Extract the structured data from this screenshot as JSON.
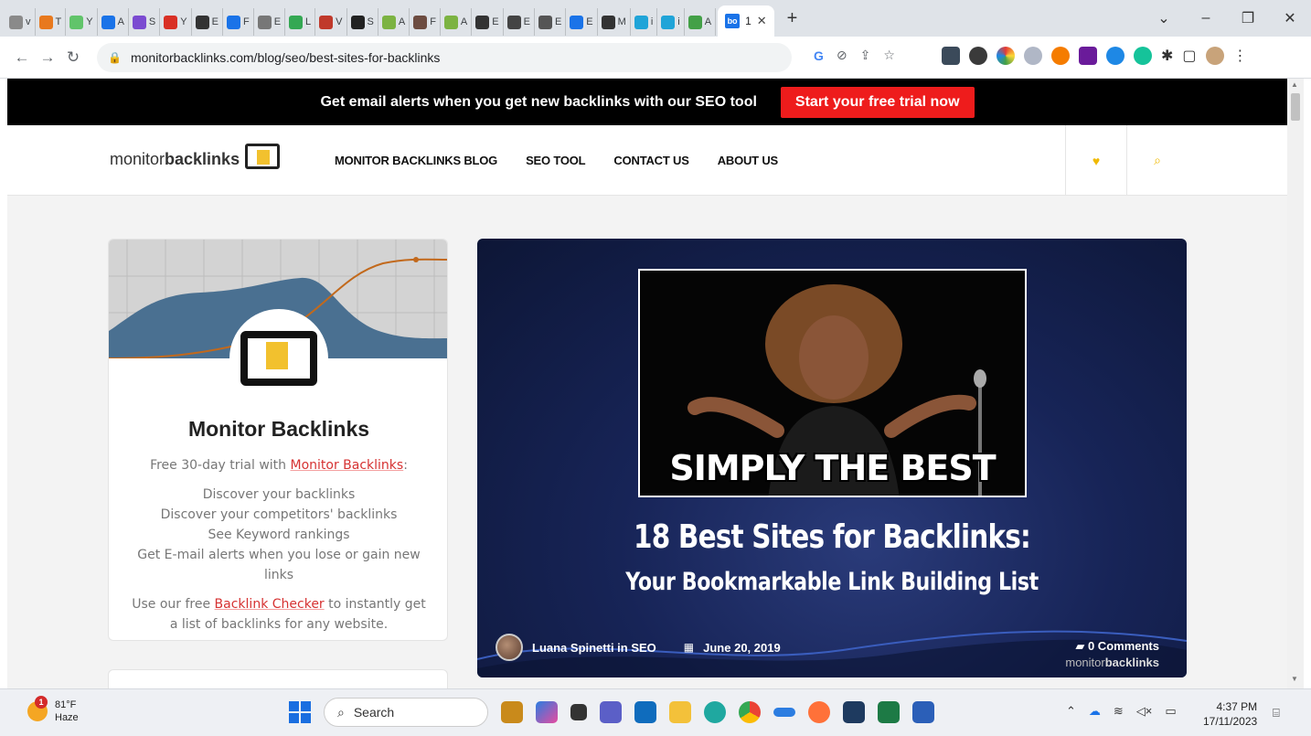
{
  "browser": {
    "tabs": [
      {
        "label": "v",
        "color": "#8a8a8a"
      },
      {
        "label": "T",
        "color": "#e8791e"
      },
      {
        "label": "Y",
        "color": "#61c46a"
      },
      {
        "label": "A",
        "color": "#1a73e8"
      },
      {
        "label": "S",
        "color": "#7b4bd1"
      },
      {
        "label": "Y",
        "color": "#d93025"
      },
      {
        "label": "E",
        "color": "#333333"
      },
      {
        "label": "F",
        "color": "#1a73e8"
      },
      {
        "label": "E",
        "color": "#777777"
      },
      {
        "label": "L",
        "color": "#34a853"
      },
      {
        "label": "V",
        "color": "#c0392b"
      },
      {
        "label": "S",
        "color": "#222222"
      },
      {
        "label": "A",
        "color": "#7cb342"
      },
      {
        "label": "F",
        "color": "#6d4c41"
      },
      {
        "label": "A",
        "color": "#7cb342"
      },
      {
        "label": "E",
        "color": "#333333"
      },
      {
        "label": "E",
        "color": "#444444"
      },
      {
        "label": "E",
        "color": "#555555"
      },
      {
        "label": "E",
        "color": "#1a73e8"
      },
      {
        "label": "M",
        "color": "#333333"
      },
      {
        "label": "i",
        "color": "#20a4d8"
      },
      {
        "label": "i",
        "color": "#20a4d8"
      },
      {
        "label": "A",
        "color": "#43a047"
      }
    ],
    "active_tab": {
      "title": "1",
      "favicon_text": "bo"
    },
    "url": "monitorbacklinks.com/blog/seo/best-sites-for-backlinks"
  },
  "promo": {
    "text": "Get email alerts when you get new backlinks with our SEO tool",
    "button": "Start your free trial now"
  },
  "header": {
    "logo_light": "monitor",
    "logo_bold": "backlinks",
    "nav": [
      "MONITOR BACKLINKS BLOG",
      "SEO TOOL",
      "CONTACT US",
      "ABOUT US"
    ]
  },
  "sidebar": {
    "title": "Monitor Backlinks",
    "intro_prefix": "Free 30-day trial with ",
    "intro_link": "Monitor Backlinks",
    "intro_suffix": ":",
    "features": [
      "Discover your backlinks",
      "Discover your competitors' backlinks",
      "See Keyword rankings",
      "Get E-mail alerts when you lose or gain new links"
    ],
    "checker_prefix": "Use our free ",
    "checker_link": "Backlink Checker",
    "checker_suffix": " to instantly get a list of backlinks for any website."
  },
  "post": {
    "image_caption": "SIMPLY THE BEST",
    "title": "18 Best Sites for Backlinks:",
    "subtitle": "Your Bookmarkable Link Building List",
    "author_line": "Luana Spinetti in SEO",
    "date": "June 20, 2019",
    "comments": "0 Comments",
    "logo_light": "monitor",
    "logo_bold": "backlinks"
  },
  "taskbar": {
    "temperature": "81°F",
    "condition": "Haze",
    "search_placeholder": "Search",
    "time": "4:37 PM",
    "date": "17/11/2023"
  }
}
